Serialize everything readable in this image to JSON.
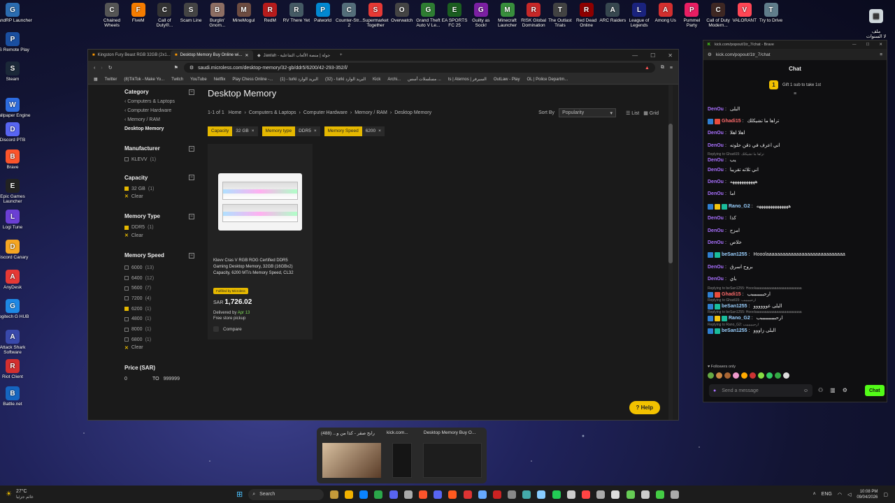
{
  "desktop_left": [
    {
      "label": "GrandRP Launcher",
      "color": "#2b6cb0",
      "glyph": "G"
    },
    {
      "label": "PS Remote Play",
      "color": "#1a4fa0",
      "glyph": "P"
    },
    {
      "label": "Steam",
      "color": "#1b2838",
      "glyph": "S"
    },
    {
      "label": "Wallpaper Engine",
      "color": "#2d6cdf",
      "glyph": "W"
    },
    {
      "label": "Discord PTB",
      "color": "#5865f2",
      "glyph": "D"
    },
    {
      "label": "Brave",
      "color": "#fb542b",
      "glyph": "B"
    },
    {
      "label": "Epic Games Launcher",
      "color": "#222",
      "glyph": "E"
    },
    {
      "label": "Logi Tune",
      "color": "#6b3fd4",
      "glyph": "L"
    },
    {
      "label": "Discord Canary",
      "color": "#f5a623",
      "glyph": "D"
    },
    {
      "label": "AnyDesk",
      "color": "#e53935",
      "glyph": "A"
    },
    {
      "label": "Logitech G HUB",
      "color": "#1e88e5",
      "glyph": "G"
    },
    {
      "label": "Attack Shark Software",
      "color": "#3949ab",
      "glyph": "A"
    },
    {
      "label": "Riot Client",
      "color": "#d32f2f",
      "glyph": "R"
    },
    {
      "label": "Battle.net",
      "color": "#1565c0",
      "glyph": "B"
    }
  ],
  "desktop_top": [
    {
      "label": "Chained Wheels",
      "color": "#555",
      "glyph": "C"
    },
    {
      "label": "FiveM",
      "color": "#f57c00",
      "glyph": "F"
    },
    {
      "label": "Call of Duty®...",
      "color": "#333",
      "glyph": "C"
    },
    {
      "label": "Scam Line",
      "color": "#444",
      "glyph": "S"
    },
    {
      "label": "Burglin' Gnom...",
      "color": "#8d6e63",
      "glyph": "B"
    },
    {
      "label": "MineMogul",
      "color": "#6d4c41",
      "glyph": "M"
    },
    {
      "label": "RedM",
      "color": "#b71c1c",
      "glyph": "R"
    },
    {
      "label": "RV There Yet",
      "color": "#455a64",
      "glyph": "R"
    },
    {
      "label": "Palworld",
      "color": "#0288d1",
      "glyph": "P"
    },
    {
      "label": "Counter-Str... 2",
      "color": "#546e7a",
      "glyph": "C"
    },
    {
      "label": "Supermarket Together",
      "color": "#e53935",
      "glyph": "S"
    },
    {
      "label": "Overwatch",
      "color": "#444",
      "glyph": "O"
    },
    {
      "label": "Grand Theft Auto V Le...",
      "color": "#2e7d32",
      "glyph": "G"
    },
    {
      "label": "EA SPORTS FC 25",
      "color": "#1b5e20",
      "glyph": "E"
    },
    {
      "label": "Guilty as Sock!",
      "color": "#7b1fa2",
      "glyph": "G"
    },
    {
      "label": "Minecraft Launcher",
      "color": "#388e3c",
      "glyph": "M"
    },
    {
      "label": "RISK Global Domination",
      "color": "#c62828",
      "glyph": "R"
    },
    {
      "label": "The Outlast Trials",
      "color": "#424242",
      "glyph": "T"
    },
    {
      "label": "Red Dead Online",
      "color": "#8e0000",
      "glyph": "R"
    },
    {
      "label": "ARC Raiders",
      "color": "#37474f",
      "glyph": "A"
    },
    {
      "label": "League of Legends",
      "color": "#1a237e",
      "glyph": "L"
    },
    {
      "label": "Among Us",
      "color": "#d32f2f",
      "glyph": "A"
    },
    {
      "label": "Pummel Party",
      "color": "#e91e63",
      "glyph": "P"
    },
    {
      "label": "Call of Duty Modern...",
      "color": "#3e2723",
      "glyph": "C"
    },
    {
      "label": "VALORANT",
      "color": "#ff4655",
      "glyph": "V"
    },
    {
      "label": "Try to Drive",
      "color": "#607d8b",
      "glyph": "T"
    }
  ],
  "desktop_corner_label": "ملف\nلا السنوات",
  "browser": {
    "tabs": [
      "Kingston Fury Beast RGB 32GB (2x1...",
      "Desktop Memory Buy Online wi...",
      "Jawlah - جولة | منصة الألعاب التفاعلية"
    ],
    "url": "saudi.microless.com/desktop-memory/32-gb/ddr5/6200/42-293-352/l/",
    "bookmarks": [
      "Twitter",
      "(8)TikTok - Make Yo...",
      "Twitch",
      "YouTube",
      "Netflix",
      "Play Chess Online -...",
      "(1) - turki البريد الوارد",
      "(32) - turki البريد الوارد",
      "Kick",
      "Archi...",
      "مسلسلات أسس ...",
      "ts | Aternos | السيرفر",
      "OutLaw - Play",
      "OL | Police Departm..."
    ],
    "sidebar": {
      "category_title": "Category",
      "category_links": [
        "Computers & Laptops",
        "Computer Hardware",
        "Memory / RAM"
      ],
      "category_current": "Desktop Memory",
      "manufacturer_title": "Manufacturer",
      "manufacturer": [
        {
          "label": "KLEVV",
          "count": "(1)",
          "on": false
        }
      ],
      "capacity_title": "Capacity",
      "capacity": [
        {
          "label": "32 GB",
          "count": "(1)",
          "on": true
        }
      ],
      "memtype_title": "Memory Type",
      "memtype": [
        {
          "label": "DDR5",
          "count": "(1)",
          "on": true
        }
      ],
      "memspeed_title": "Memory Speed",
      "memspeed": [
        {
          "label": "6000",
          "count": "(13)",
          "on": false
        },
        {
          "label": "6400",
          "count": "(12)",
          "on": false
        },
        {
          "label": "5600",
          "count": "(7)",
          "on": false
        },
        {
          "label": "7200",
          "count": "(4)",
          "on": false
        },
        {
          "label": "6200",
          "count": "(1)",
          "on": true
        },
        {
          "label": "4800",
          "count": "(1)",
          "on": false
        },
        {
          "label": "8000",
          "count": "(1)",
          "on": false
        },
        {
          "label": "6800",
          "count": "(1)",
          "on": false
        }
      ],
      "clear": "Clear",
      "price_title": "Price (SAR)",
      "price_min": "0",
      "price_to": "TO",
      "price_max": "999999"
    },
    "main": {
      "title": "Desktop Memory",
      "count": "1-1 of 1",
      "breadcrumb": [
        "Home",
        "Computers & Laptops",
        "Computer Hardware",
        "Memory / RAM",
        "Desktop Memory"
      ],
      "sort_label": "Sort By",
      "sort_value": "Popularity",
      "view_list": "List",
      "view_grid": "Grid",
      "filters": [
        {
          "k": "Capacity",
          "v": "32 GB"
        },
        {
          "k": "Memory type",
          "v": "DDR5"
        },
        {
          "k": "Memory Speed",
          "v": "6200"
        }
      ],
      "product": {
        "name": "Klevv Cras V RGB ROG Certified DDR5 Gaming Desktop Memory, 32GB (16GBx2) Capacity, 6200 MT/s Memory Speed, CL32",
        "badge": "Fulfilled by Microless",
        "currency": "SAR",
        "price": "1,726.02",
        "delivered_prefix": "Delivered by",
        "delivered_date": "Apr 13",
        "pickup": "Free store pickup",
        "compare": "Compare"
      },
      "help": "Help"
    }
  },
  "chat": {
    "url": "kick.com/popout/1tr_7/chat",
    "title_suffix": "kick.com/popout/1tr_7/chat - Brave",
    "header": "Chat",
    "gift": "Gift 1 sub to take 1st",
    "messages": [
      {
        "user": "DenOu",
        "color": "#a970ff",
        "text": "البلى",
        "badges": []
      },
      {
        "user": "Ghadi15",
        "color": "#ff6b6b",
        "text": "تراها ما تشيكلك",
        "badges": [
          "#2f7fd1",
          "#e74c3c"
        ]
      },
      {
        "user": "DenOu",
        "color": "#a970ff",
        "text": "اهلا اهلا",
        "badges": []
      },
      {
        "user": "DenOu",
        "color": "#a970ff",
        "text": "اني اعرف في ذقن حلوته",
        "badges": []
      },
      {
        "reply": "Replying to Ghadi15: تراها ما تشيكلك",
        "user": "DenOu",
        "color": "#a970ff",
        "text": "يب",
        "badges": []
      },
      {
        "user": "DenOu",
        "color": "#a970ff",
        "text": "اني ثلاثه تقريبا",
        "badges": []
      },
      {
        "user": "DenOu",
        "color": "#a970ff",
        "text": "هههههههههههه",
        "badges": []
      },
      {
        "user": "DenOu",
        "color": "#a970ff",
        "text": "اما",
        "badges": []
      },
      {
        "user": "Rano_G2",
        "color": "#9ad0ff",
        "text": "ههههههههههههههه",
        "badges": [
          "#2f7fd1",
          "#f1c40f",
          "#1abc9c"
        ]
      },
      {
        "user": "DenOu",
        "color": "#a970ff",
        "text": "كذا",
        "badges": []
      },
      {
        "user": "DenOu",
        "color": "#a970ff",
        "text": "امزح",
        "badges": []
      },
      {
        "user": "DenOu",
        "color": "#a970ff",
        "text": "خلاص",
        "badges": []
      },
      {
        "user": "beSan1255",
        "color": "#9ad0ff",
        "text": "Hooolaaaaaaaaaaaaaaaaaaaaaaaaaaaaa",
        "badges": [
          "#2f7fd1",
          "#1abc9c"
        ]
      },
      {
        "user": "DenOu",
        "color": "#a970ff",
        "text": "بروح اسرق",
        "badges": []
      },
      {
        "user": "DenOu",
        "color": "#a970ff",
        "text": "باي",
        "badges": []
      },
      {
        "reply": "Replying to beSan1255: Hooolaaaaaaaaaaaaaaaaaaaaaaaa",
        "user": "Ghadi15",
        "color": "#ff6b6b",
        "text": "ارحببببببببب",
        "badges": [
          "#2f7fd1",
          "#e74c3c"
        ]
      },
      {
        "reply": "Replying to Ghadi15: ارحببببببب",
        "user": "beSan1255",
        "color": "#9ad0ff",
        "text": "البلى عوووووو",
        "badges": [
          "#2f7fd1",
          "#1abc9c"
        ]
      },
      {
        "reply": "Replying to beSan1255: Hooolaaaaaaaaaaaaaaaaaaaaaaaa",
        "user": "Rano_G2",
        "color": "#9ad0ff",
        "text": "ارحببببببببببب",
        "badges": [
          "#2f7fd1",
          "#f1c40f",
          "#1abc9c"
        ]
      },
      {
        "reply": "Replying to Rano_G2: ارحبببببببب",
        "user": "beSan1255",
        "color": "#9ad0ff",
        "text": "البلى زاووو",
        "badges": [
          "#2f7fd1",
          "#1abc9c"
        ]
      }
    ],
    "followers_only": "Followers only",
    "placeholder": "Send a message",
    "send": "Chat"
  },
  "taskbar": {
    "weather": "27°C",
    "weather_sub": "غائم جزئيا",
    "search": "Search",
    "lang": "ENG",
    "time": "10:08 PM",
    "date": "09/04/2026",
    "previews": [
      "رابح صقر - كذا من و... (488)",
      "kick.com...",
      "Desktop Memory Buy O..."
    ]
  }
}
